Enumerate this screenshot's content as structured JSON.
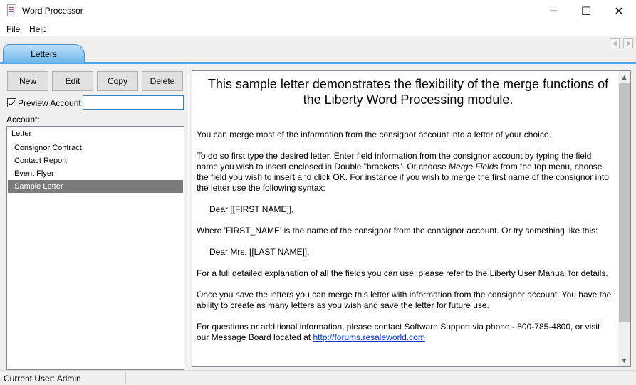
{
  "window": {
    "title": "Word Processor",
    "minimize": "─",
    "maximize": "☐",
    "close": "✕"
  },
  "menu": {
    "items": [
      "File",
      "Help"
    ]
  },
  "tabs": {
    "active": "Letters"
  },
  "toolbar": {
    "new": "New",
    "edit": "Edit",
    "copy": "Copy",
    "delete": "Delete"
  },
  "preview": {
    "label": "Preview Account",
    "checked": true,
    "input_value": "",
    "input_placeholder": ""
  },
  "account": {
    "label": "Account:",
    "root": "Letter",
    "items": [
      "Consignor Contract",
      "Contact Report",
      "Event Flyer",
      "Sample Letter"
    ],
    "selected": "Sample Letter"
  },
  "document": {
    "title": "This sample letter demonstrates the flexibility of the merge functions of the Liberty Word Processing module.",
    "p1": "You can merge most of the information from the consignor account into a letter of your choice.",
    "p2a": "To do so first type the desired letter. Enter field information from the consignor account by typing the field name you wish to insert enclosed in Double \"brackets\".   Or choose ",
    "p2_em": "Merge Fields",
    "p2b": " from the top menu, choose the field you wish to insert and click OK.  For instance if you wish to merge the first name of the consignor into the letter use the following syntax:",
    "ex1": "Dear [[FIRST NAME]],",
    "p3": "Where 'FIRST_NAME' is the name of the consignor from the consignor account. Or try something like this:",
    "ex2": "Dear Mrs. [[LAST NAME]],",
    "p4": "For a full detailed explanation of all the fields you can use, please refer to the Liberty User Manual for details.",
    "p5": "Once you save the letters you can merge this letter with information from the consignor account. You have the ability to create as many letters as you wish and save the letter for future use.",
    "p6a": "For questions or additional information, please contact Software Support via phone - 800-785-4800, or visit our Message Board located at ",
    "p6_link": "http://forums.resaleworld.com"
  },
  "status": {
    "user": "Current User: Admin"
  },
  "colors": {
    "tab_active": "#6bb5ea",
    "tab_border": "#57a6e3",
    "selection": "#7a7a7a",
    "merge_red": "#e01010",
    "merge_blue": "#1a1a8a"
  },
  "icons": {
    "app": "document-icon",
    "nav_prev": "triangle-left-icon",
    "nav_next": "triangle-right-icon",
    "scroll_up": "chevron-up-icon",
    "scroll_down": "chevron-down-icon"
  }
}
